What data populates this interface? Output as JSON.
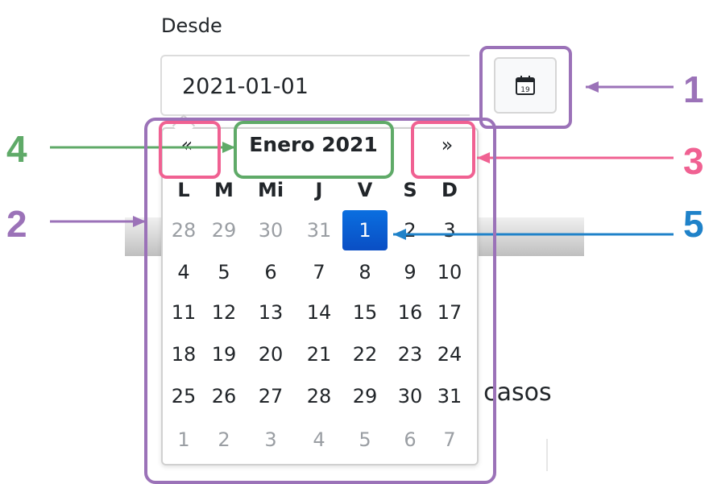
{
  "field": {
    "label": "Desde",
    "value": "2021-01-01",
    "calendar_icon_day": "19"
  },
  "background": {
    "partial_text": "s casos"
  },
  "calendar": {
    "prev_label": "«",
    "next_label": "»",
    "month_title": "Enero 2021",
    "weekdays": [
      "L",
      "M",
      "Mi",
      "J",
      "V",
      "S",
      "D"
    ],
    "weeks": [
      [
        "28",
        "29",
        "30",
        "31",
        "1",
        "2",
        "3"
      ],
      [
        "4",
        "5",
        "6",
        "7",
        "8",
        "9",
        "10"
      ],
      [
        "11",
        "12",
        "13",
        "14",
        "15",
        "16",
        "17"
      ],
      [
        "18",
        "19",
        "20",
        "21",
        "22",
        "23",
        "24"
      ],
      [
        "25",
        "26",
        "27",
        "28",
        "29",
        "30",
        "31"
      ],
      [
        "1",
        "2",
        "3",
        "4",
        "5",
        "6",
        "7"
      ]
    ],
    "selected": "1"
  },
  "annotations": {
    "labels": [
      "1",
      "2",
      "3",
      "4",
      "5"
    ],
    "colors": {
      "purple": "#9b72b8",
      "pink": "#f06192",
      "green": "#5faa68",
      "blue": "#1f82c9"
    }
  }
}
